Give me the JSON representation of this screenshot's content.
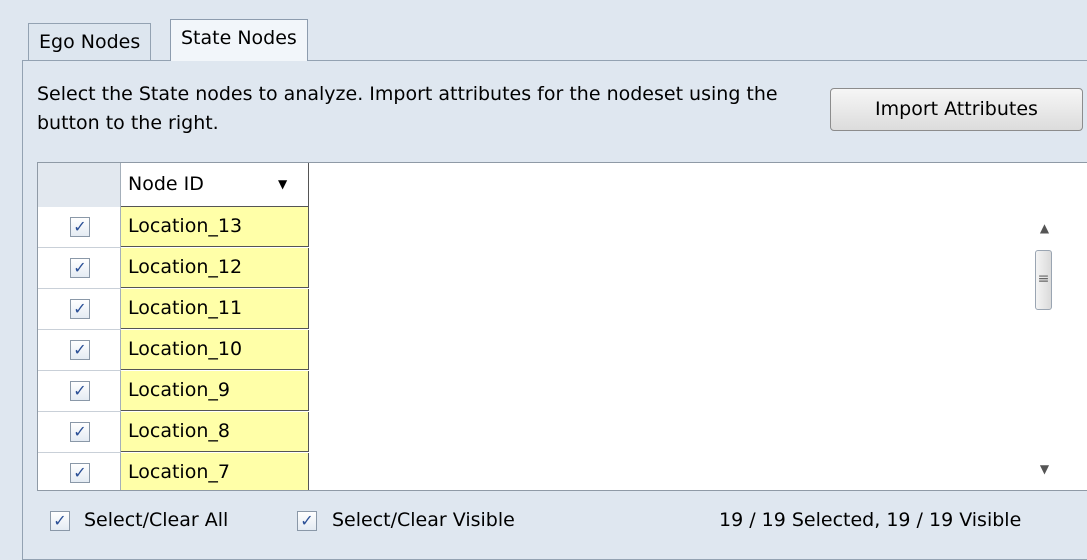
{
  "tabs": [
    {
      "label": "Ego Nodes",
      "active": false
    },
    {
      "label": "State Nodes",
      "active": true
    }
  ],
  "description": "Select the State nodes to analyze. Import attributes for the nodeset using the button to the right.",
  "import_button_label": "Import Attributes",
  "grid": {
    "column_header": "Node ID",
    "sort_icon": "triangle-down",
    "rows": [
      {
        "id": "Location_13",
        "checked": true
      },
      {
        "id": "Location_12",
        "checked": true
      },
      {
        "id": "Location_11",
        "checked": true
      },
      {
        "id": "Location_10",
        "checked": true
      },
      {
        "id": "Location_9",
        "checked": true
      },
      {
        "id": "Location_8",
        "checked": true
      },
      {
        "id": "Location_7",
        "checked": true
      }
    ]
  },
  "footer": {
    "select_all_label": "Select/Clear All",
    "select_visible_label": "Select/Clear Visible",
    "status": "19 / 19 Selected, 19 / 19 Visible"
  },
  "colors": {
    "background": "#dfe7f0",
    "cell_highlight": "#ffffa8",
    "check": "#2a4f96"
  }
}
